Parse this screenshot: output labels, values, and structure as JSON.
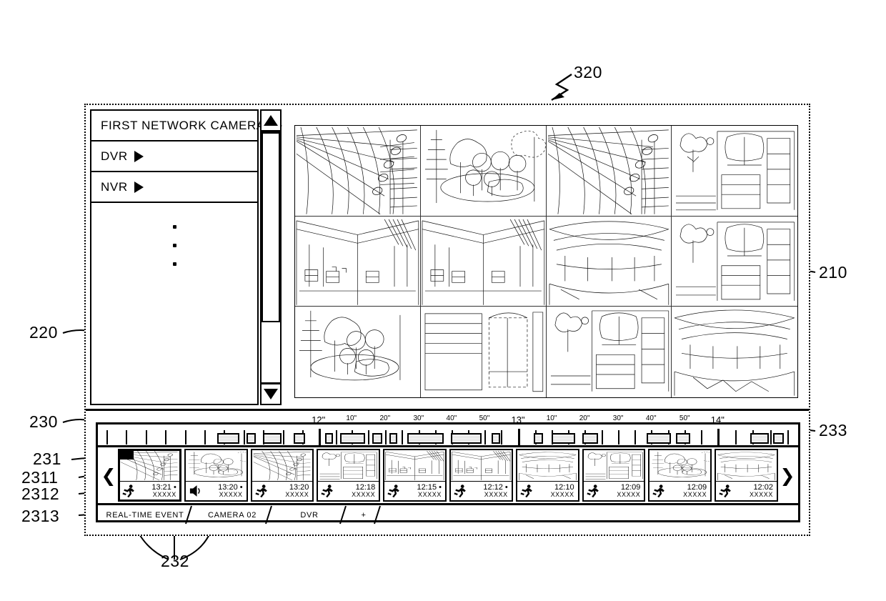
{
  "figure": {
    "callouts": [
      {
        "id": "320",
        "label": "320"
      },
      {
        "id": "210",
        "label": "210"
      },
      {
        "id": "220",
        "label": "220"
      },
      {
        "id": "230",
        "label": "230"
      },
      {
        "id": "231",
        "label": "231"
      },
      {
        "id": "232",
        "label": "232"
      },
      {
        "id": "233",
        "label": "233"
      },
      {
        "id": "2311",
        "label": "2311"
      },
      {
        "id": "2312",
        "label": "2312"
      },
      {
        "id": "2313",
        "label": "2313"
      }
    ]
  },
  "sidebar": {
    "items": [
      {
        "label": "FIRST NETWORK CAMERA",
        "expander": "triangle-right-icon"
      },
      {
        "label": "DVR",
        "expander": "triangle-right-icon"
      },
      {
        "label": "NVR",
        "expander": "triangle-right-icon"
      }
    ],
    "ellipsis": "vertical-ellipsis",
    "scrollbar": {
      "up": "triangle-up-icon",
      "down": "triangle-down-icon"
    }
  },
  "grid": {
    "rows": 3,
    "columns": 4,
    "cells": [
      {
        "scene": "ceiling-lattice"
      },
      {
        "scene": "park-trees"
      },
      {
        "scene": "ceiling-lattice"
      },
      {
        "scene": "storefront"
      },
      {
        "scene": "interior-hall"
      },
      {
        "scene": "interior-hall"
      },
      {
        "scene": "lobby-dome"
      },
      {
        "scene": "storefront"
      },
      {
        "scene": "park-trees"
      },
      {
        "scene": "corridor-doors"
      },
      {
        "scene": "storefront"
      },
      {
        "scene": "lobby-dome"
      }
    ]
  },
  "timeline": {
    "ruler_labels": [
      {
        "text": "12\"",
        "pos": 31.5,
        "big": true
      },
      {
        "text": "10\"",
        "pos": 36.2,
        "big": false
      },
      {
        "text": "20\"",
        "pos": 41.0,
        "big": false
      },
      {
        "text": "30\"",
        "pos": 45.8,
        "big": false
      },
      {
        "text": "40\"",
        "pos": 50.5,
        "big": false
      },
      {
        "text": "50\"",
        "pos": 55.2,
        "big": false
      },
      {
        "text": "13\"",
        "pos": 60.0,
        "big": true
      },
      {
        "text": "10\"",
        "pos": 64.8,
        "big": false
      },
      {
        "text": "20\"",
        "pos": 69.5,
        "big": false
      },
      {
        "text": "30\"",
        "pos": 74.3,
        "big": false
      },
      {
        "text": "40\"",
        "pos": 79.0,
        "big": false
      },
      {
        "text": "50\"",
        "pos": 83.8,
        "big": false
      },
      {
        "text": "14\"",
        "pos": 88.5,
        "big": true
      }
    ],
    "ticks": [
      1.2,
      4.0,
      6.8,
      9.6,
      12.4,
      15.2,
      18.0,
      20.8,
      23.6,
      26.4,
      29.2,
      31.5,
      34.0,
      36.2,
      38.6,
      41.0,
      43.4,
      45.8,
      48.2,
      50.5,
      52.9,
      55.2,
      57.6,
      60.0,
      62.4,
      64.8,
      67.1,
      69.5,
      71.9,
      74.3,
      76.6,
      79.0,
      81.4,
      83.8,
      86.1,
      88.5,
      91.0,
      93.5,
      96.0,
      98.5
    ],
    "major_ticks": [
      31.5,
      60.0,
      88.5
    ],
    "event_blocks": [
      {
        "start": 17.0,
        "width": 3.2
      },
      {
        "start": 21.2,
        "width": 1.4
      },
      {
        "start": 23.6,
        "width": 2.6
      },
      {
        "start": 28.0,
        "width": 1.6
      },
      {
        "start": 32.4,
        "width": 1.2
      },
      {
        "start": 34.6,
        "width": 3.6
      },
      {
        "start": 39.2,
        "width": 1.4
      },
      {
        "start": 41.6,
        "width": 1.2
      },
      {
        "start": 44.2,
        "width": 5.2
      },
      {
        "start": 50.4,
        "width": 4.4
      },
      {
        "start": 56.2,
        "width": 1.2
      },
      {
        "start": 62.2,
        "width": 1.4
      },
      {
        "start": 64.8,
        "width": 3.4
      },
      {
        "start": 69.2,
        "width": 2.2
      },
      {
        "start": 78.4,
        "width": 3.4
      },
      {
        "start": 82.6,
        "width": 2.0
      },
      {
        "start": 93.2,
        "width": 2.6
      },
      {
        "start": 96.4,
        "width": 1.6
      }
    ]
  },
  "thumbnails": {
    "prev_arrow": "chevron-left-icon",
    "next_arrow": "chevron-right-icon",
    "sub_label": "XXXXX",
    "items": [
      {
        "time": "13:21",
        "dot": true,
        "icon": "running-person-icon",
        "scene": "ceiling-lattice",
        "selected": true
      },
      {
        "time": "13:20",
        "dot": true,
        "icon": "speaker-icon",
        "scene": "park-trees",
        "selected": false
      },
      {
        "time": "13:20",
        "dot": false,
        "icon": "running-person-icon",
        "scene": "ceiling-lattice",
        "selected": false
      },
      {
        "time": "12:18",
        "dot": false,
        "icon": "running-person-icon",
        "scene": "storefront",
        "selected": false
      },
      {
        "time": "12:15",
        "dot": true,
        "icon": "running-person-icon",
        "scene": "interior-hall",
        "selected": false
      },
      {
        "time": "12:12",
        "dot": true,
        "icon": "running-person-icon",
        "scene": "interior-hall",
        "selected": false
      },
      {
        "time": "12:10",
        "dot": false,
        "icon": "running-person-icon",
        "scene": "lobby-dome",
        "selected": false
      },
      {
        "time": "12:09",
        "dot": false,
        "icon": "running-person-icon",
        "scene": "storefront",
        "selected": false
      },
      {
        "time": "12:09",
        "dot": false,
        "icon": "running-person-icon",
        "scene": "park-trees",
        "selected": false
      },
      {
        "time": "12:02",
        "dot": false,
        "icon": "running-person-icon",
        "scene": "lobby-dome",
        "selected": false
      }
    ]
  },
  "tabs": {
    "items": [
      {
        "label": "REAL-TIME EVENT",
        "width": 132
      },
      {
        "label": "CAMERA 02",
        "width": 112
      },
      {
        "label": "DVR",
        "width": 104
      },
      {
        "label": "+",
        "width": 48
      }
    ]
  },
  "colors": {
    "ink": "#000000",
    "paper": "#ffffff",
    "hatch": "#d9d9d9"
  }
}
